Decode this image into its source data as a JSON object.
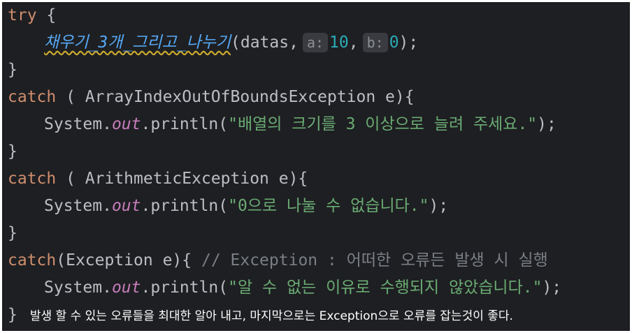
{
  "code": {
    "l1": {
      "kw": "try",
      "brace": " {"
    },
    "l2": {
      "method": "채우기_3개_그리고_나누기",
      "open": "(datas,",
      "hint_a": "a:",
      "val_a": "10",
      "comma": ",",
      "hint_b": "b:",
      "val_b": "0",
      "close": ");"
    },
    "l3": {
      "brace": "}"
    },
    "l4": {
      "kw": "catch",
      "rest": " ( ArrayIndexOutOfBoundsException e){"
    },
    "l5": {
      "pre": "System.",
      "field": "out",
      "mid": ".println(",
      "str": "\"배열의 크기를 3 이상으로 늘려 주세요.\"",
      "end": ");"
    },
    "l6": {
      "brace": "}"
    },
    "l7": {
      "kw": "catch",
      "rest": " ( ArithmeticException e){"
    },
    "l8": {
      "pre": "System.",
      "field": "out",
      "mid": ".println(",
      "str": "\"0으로 나눌 수 없습니다.\"",
      "end": ");"
    },
    "l9": {
      "brace": "}"
    },
    "l10": {
      "kw": "catch",
      "rest": "(Exception e){ ",
      "comment": "// Exception : 어떠한 오류든 발생 시 실행"
    },
    "l11": {
      "pre": "System.",
      "field": "out",
      "mid": ".println(",
      "str": "\"알 수 없는 이유로 수행되지 않았습니다.\"",
      "end": ");"
    },
    "l12": {
      "brace": "}",
      "note": "발생 할 수 있는 오류들을 최대한 알아 내고, 마지막으로는 Exception으로 오류를 잡는것이 좋다."
    }
  },
  "colors": {
    "background": "#1e1f22",
    "keyword": "#cf8e6d",
    "string": "#6aab73",
    "number": "#2aacb8",
    "field": "#c77dbb",
    "comment": "#7a7e85",
    "method": "#56a8f5"
  }
}
